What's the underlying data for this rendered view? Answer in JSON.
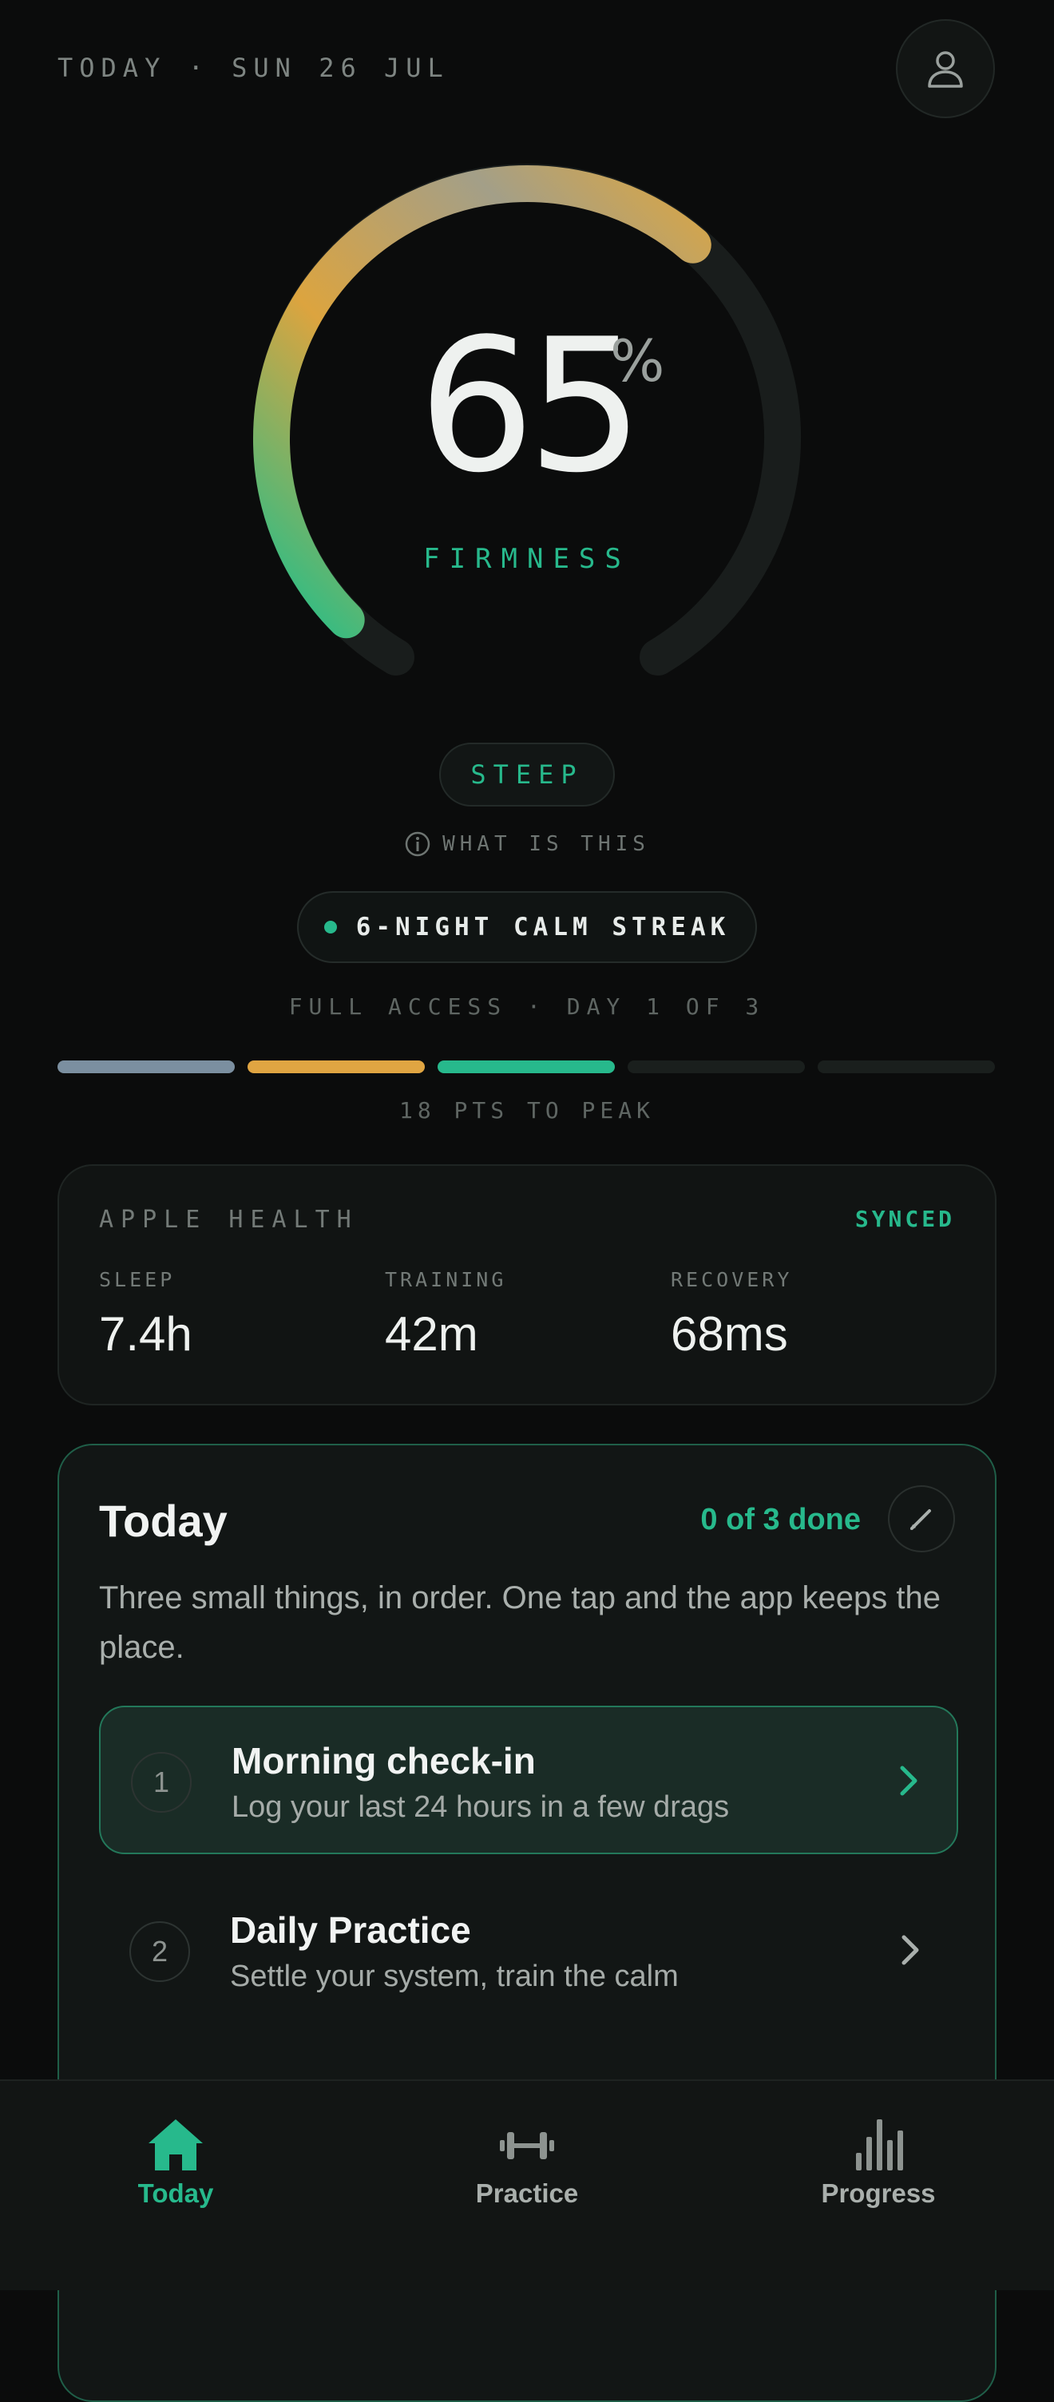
{
  "header": {
    "date": "TODAY · SUN 26 JUL",
    "avatar_icon": "user-icon"
  },
  "gauge": {
    "value": "65",
    "unit": "%",
    "label": "FIRMNESS",
    "fill_fraction": 0.65
  },
  "badge": {
    "label": "STEEP"
  },
  "info": {
    "icon": "info-icon",
    "label": "WHAT IS THIS"
  },
  "streak": {
    "label": "6-NIGHT CALM STREAK"
  },
  "access": {
    "label": "FULL ACCESS · DAY 1 OF 3"
  },
  "progress": {
    "segments": [
      {
        "color": "#7b8fa0"
      },
      {
        "color": "#e0a542"
      },
      {
        "color": "#27b98c"
      },
      {
        "color": "#1a1f1d"
      },
      {
        "color": "#1a1f1d"
      }
    ],
    "label": "18 PTS TO PEAK"
  },
  "health": {
    "title": "APPLE HEALTH",
    "status": "SYNCED",
    "metrics": [
      {
        "label": "SLEEP",
        "value": "7.4h"
      },
      {
        "label": "TRAINING",
        "value": "42m"
      },
      {
        "label": "RECOVERY",
        "value": "68ms"
      }
    ]
  },
  "today": {
    "title": "Today",
    "done": "0 of 3 done",
    "edit_icon": "pencil-icon",
    "description": "Three small things, in order. One tap and the app keeps the place.",
    "tasks": [
      {
        "number": "1",
        "title": "Morning check-in",
        "subtitle": "Log your last 24 hours in a few drags"
      },
      {
        "number": "2",
        "title": "Daily Practice",
        "subtitle": "Settle your system, train the calm"
      }
    ]
  },
  "nav": {
    "items": [
      {
        "label": "Today",
        "icon": "home-icon",
        "active": true
      },
      {
        "label": "Practice",
        "icon": "dumbbell-icon",
        "active": false
      },
      {
        "label": "Progress",
        "icon": "bar-chart-icon",
        "active": false
      }
    ]
  },
  "colors": {
    "accent": "#27b98c",
    "amber": "#e0a542",
    "background": "#0b0c0c"
  }
}
